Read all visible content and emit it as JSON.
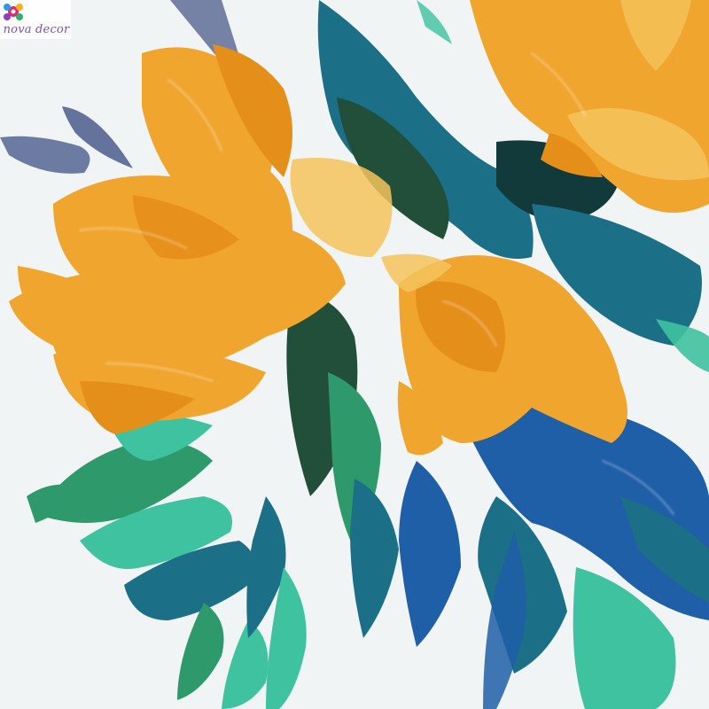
{
  "brand": {
    "text": "nova decor",
    "text_color": "#7a4fb0",
    "logo_icon": "flower-dots-logo-icon",
    "logo_colors": [
      "#e3266f",
      "#2e9be0",
      "#f5b21c",
      "#8a3fc2",
      "#27b36b"
    ]
  },
  "palette": {
    "background": "#f1f4f4",
    "orange": "#f0a52e",
    "deep_orange": "#e58f1b",
    "yellow": "#f4c35a",
    "teal": "#1b6f86",
    "blue": "#1f5fa8",
    "green": "#2e9a6c",
    "mint": "#3fc2a0",
    "dark_green": "#214f3a",
    "slate": "#4b5c8c"
  }
}
